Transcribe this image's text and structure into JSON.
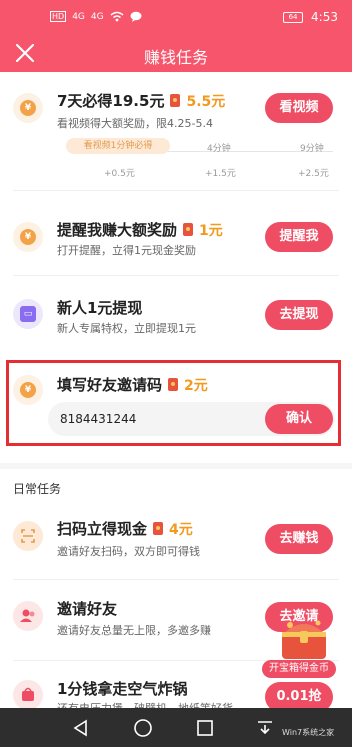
{
  "status_bar": {
    "left_icons": [
      "HD",
      "4G",
      "4G",
      "wifi",
      "chat"
    ],
    "battery": "64",
    "time": "4:53"
  },
  "header": {
    "title": "赚钱任务"
  },
  "tasks": [
    {
      "title": "7天必得19.5元",
      "reward": "5.5元",
      "subtitle": "看视频得大额奖励，限4.25-5.4",
      "button": "看视频",
      "progress": {
        "pill": "看视频1分钟必得",
        "ticks": [
          "4分钟",
          "9分钟"
        ],
        "rewards": [
          "+0.5元",
          "+1.5元",
          "+2.5元"
        ]
      }
    },
    {
      "title": "提醒我赚大额奖励",
      "reward": "1元",
      "subtitle": "打开提醒，立得1元现金奖励",
      "button": "提醒我"
    },
    {
      "title": "新人1元提现",
      "reward": "",
      "subtitle": "新人专属特权，立即提现1元",
      "button": "去提现"
    },
    {
      "title": "填写好友邀请码",
      "reward": "2元",
      "code": "8184431244",
      "button": "确认"
    }
  ],
  "section_title": "日常任务",
  "daily_tasks": [
    {
      "title": "扫码立得现金",
      "reward": "4元",
      "subtitle": "邀请好友扫码，双方即可得钱",
      "button": "去赚钱"
    },
    {
      "title": "邀请好友",
      "reward": "",
      "subtitle": "邀请好友总量无上限，多邀多赚",
      "button": "去邀请"
    },
    {
      "title": "1分钱拿走空气炸锅",
      "reward": "",
      "subtitle": "还有电压力煲、破壁机、地纸等好货",
      "button": "0.01抢"
    }
  ],
  "chest": {
    "label": "开宝箱得金币"
  },
  "watermark": "Win7系统之家",
  "colors": {
    "brand": "#f6556b",
    "button": "#ef4d63",
    "reward": "#f19a1e",
    "highlight": "#e52d34"
  }
}
